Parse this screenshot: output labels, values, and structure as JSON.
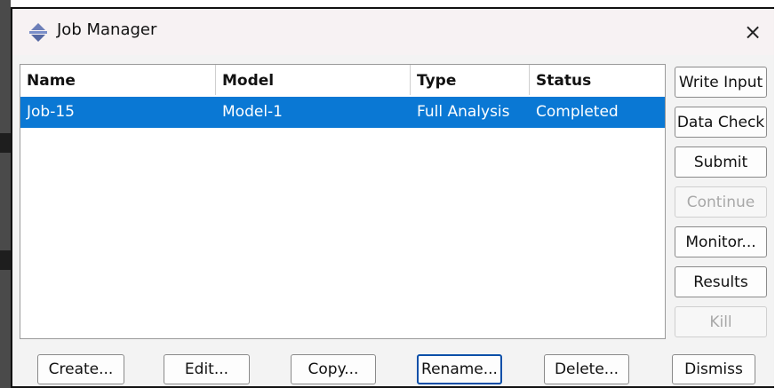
{
  "window": {
    "title": "Job Manager",
    "close_glyph": "×"
  },
  "table": {
    "columns": [
      "Name",
      "Model",
      "Type",
      "Status"
    ],
    "rows": [
      {
        "name": "Job-15",
        "model": "Model-1",
        "type": "Full Analysis",
        "status": "Completed",
        "selected": true
      }
    ]
  },
  "side_buttons": [
    {
      "label": "Write Input",
      "enabled": true
    },
    {
      "label": "Data Check",
      "enabled": true
    },
    {
      "label": "Submit",
      "enabled": true
    },
    {
      "label": "Continue",
      "enabled": false
    },
    {
      "label": "Monitor...",
      "enabled": true
    },
    {
      "label": "Results",
      "enabled": true
    },
    {
      "label": "Kill",
      "enabled": false
    }
  ],
  "bottom_buttons": [
    "Create...",
    "Edit...",
    "Copy...",
    "Rename...",
    "Delete...",
    "Dismiss"
  ],
  "colors": {
    "selection": "#0a78d4",
    "titlebar": "#f7f2f3",
    "window_bg": "#f3f3f3"
  }
}
